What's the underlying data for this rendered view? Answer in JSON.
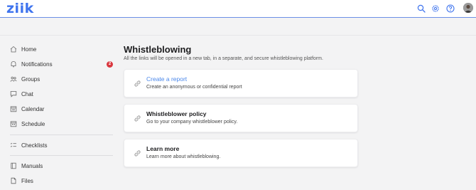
{
  "app": {
    "logo_text": "ziik"
  },
  "topbar": {
    "icons": [
      "search-icon",
      "gear-icon",
      "help-icon"
    ]
  },
  "sidebar": {
    "items": [
      {
        "label": "Home",
        "icon": "home-icon"
      },
      {
        "label": "Notifications",
        "icon": "bell-icon",
        "badge": "2"
      },
      {
        "label": "Groups",
        "icon": "groups-icon"
      },
      {
        "label": "Chat",
        "icon": "chat-icon"
      },
      {
        "label": "Calendar",
        "icon": "calendar-icon"
      },
      {
        "label": "Schedule",
        "icon": "schedule-icon"
      },
      {
        "label": "Checklists",
        "icon": "checklist-icon"
      },
      {
        "label": "Manuals",
        "icon": "manual-icon"
      },
      {
        "label": "Files",
        "icon": "file-icon"
      }
    ]
  },
  "main": {
    "title": "Whistleblowing",
    "subtitle": "All the links will be opened in a new tab, in a separate, and secure whistleblowing platform.",
    "cards": [
      {
        "title": "Create a report",
        "description": "Create an anonymous or confidential report",
        "icon": "link-icon"
      },
      {
        "title": "Whistleblower policy",
        "description": "Go to your company whistleblower policy.",
        "icon": "link-icon"
      },
      {
        "title": "Learn more",
        "description": "Learn more about whistleblowing.",
        "icon": "link-icon"
      }
    ]
  },
  "colors": {
    "accent": "#3f74ee",
    "link": "#4a87ea",
    "badge": "#d9363e",
    "background": "#f3f3f4"
  }
}
